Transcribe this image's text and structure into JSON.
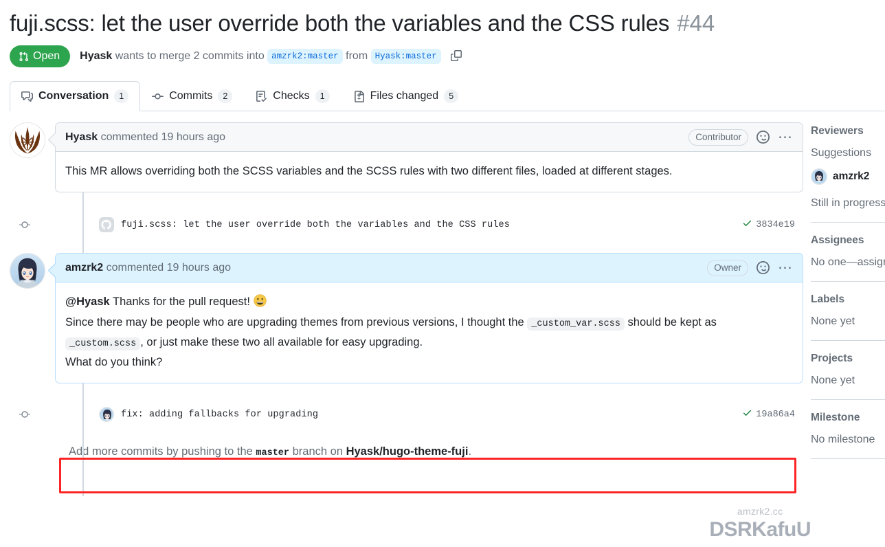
{
  "header": {
    "title": "fuji.scss: let the user override both the variables and the CSS rules",
    "number": "#44",
    "state": "Open",
    "author": "Hyask",
    "merge_text_1": "wants to merge 2 commits into",
    "base_branch": "amzrk2:master",
    "merge_text_2": "from",
    "head_branch": "Hyask:master",
    "copy_icon": "copy-icon",
    "state_icon": "pull-request-icon"
  },
  "tabs": [
    {
      "label": "Conversation",
      "count": "1",
      "icon": "comment-discussion-icon",
      "active": true
    },
    {
      "label": "Commits",
      "count": "2",
      "icon": "git-commit-icon",
      "active": false
    },
    {
      "label": "Checks",
      "count": "1",
      "icon": "checklist-icon",
      "active": false
    },
    {
      "label": "Files changed",
      "count": "5",
      "icon": "file-diff-icon",
      "active": false
    }
  ],
  "comments": [
    {
      "author": "Hyask",
      "action": "commented",
      "time": "19 hours ago",
      "role": "Contributor",
      "avatar": "jedi-order-avatar",
      "body": "This MR allows overriding both the SCSS variables and the SCSS rules with two different files, loaded at different stages.",
      "reaction_icon": "smiley-icon",
      "menu_icon": "kebab-menu-icon"
    },
    {
      "author": "amzrk2",
      "action": "commented",
      "time": "19 hours ago",
      "role": "Owner",
      "avatar": "anime-girl-avatar",
      "line1_mention": "@Hyask",
      "line1_rest": "Thanks for the pull request!",
      "line1_emoji": "grinning-face-emoji",
      "line2_a": "Since there may be people who are upgrading themes from previous versions, I thought the",
      "line2_code": "_custom_var.scss",
      "line2_b": "should be kept as",
      "line3_code": "_custom.scss",
      "line3_rest": ", or just make these two all available for easy upgrading.",
      "line4": "What do you think?",
      "reaction_icon": "smiley-icon",
      "menu_icon": "kebab-menu-icon"
    }
  ],
  "commit_rows": [
    {
      "message": "fuji.scss: let the user override both the variables and the CSS rules",
      "hash": "3834e19",
      "avatar": "github-octocat-icon",
      "status_icon": "check-icon",
      "highlighted": false
    },
    {
      "message": "fix: adding fallbacks for upgrading",
      "hash": "19a86a4",
      "avatar": "anime-girl-avatar",
      "status_icon": "check-icon",
      "highlighted": true
    }
  ],
  "footer": {
    "prefix": "Add more commits by pushing to the",
    "branch": "master",
    "middle": "branch on",
    "repo": "Hyask/hugo-theme-fuji",
    "suffix": "."
  },
  "sidebar": {
    "reviewers": {
      "title": "Reviewers",
      "subtitle": "Suggestions",
      "user": "amzrk2",
      "status": "Still in progress"
    },
    "assignees": {
      "title": "Assignees",
      "value": "No one—assign"
    },
    "labels": {
      "title": "Labels",
      "value": "None yet"
    },
    "projects": {
      "title": "Projects",
      "value": "None yet"
    },
    "milestone": {
      "title": "Milestone",
      "value": "No milestone"
    }
  },
  "watermark": {
    "top": "amzrk2.cc",
    "main": "DSRKafuU"
  },
  "colors": {
    "open_green": "#2da44e",
    "link_blue": "#0969da",
    "chip_bg": "#ddf4ff",
    "check_green": "#1a7f37",
    "highlight_red": "#fc2424",
    "border": "#d1d9e0",
    "muted": "#636c76"
  }
}
